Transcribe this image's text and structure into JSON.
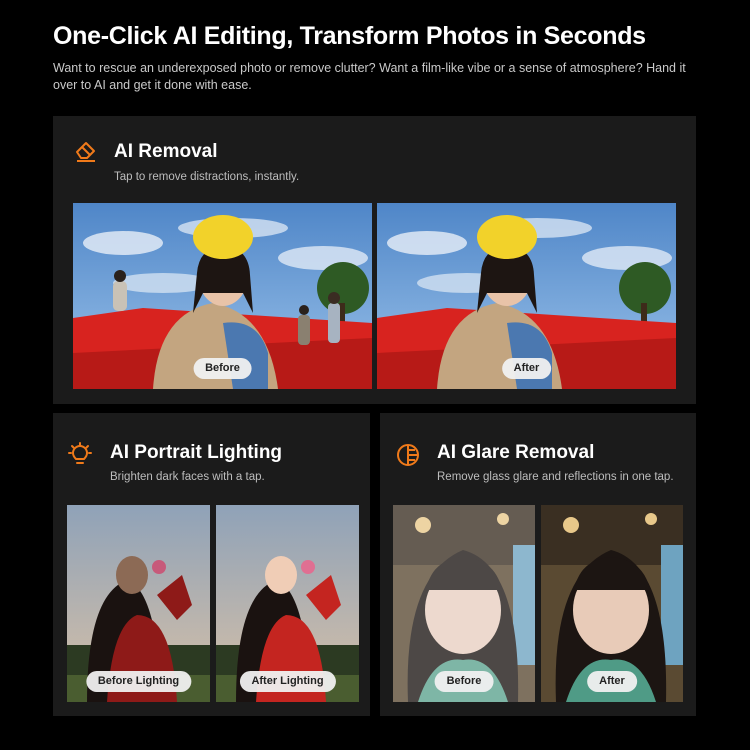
{
  "header": {
    "title": "One-Click AI Editing, Transform Photos in Seconds",
    "subtitle": "Want to rescue an underexposed photo or remove clutter? Want a film-like vibe or a sense of atmosphere? Hand it over to AI and get it done with ease."
  },
  "colors": {
    "background": "#000000",
    "card": "#1b1b1b",
    "accent": "#f07a1a",
    "pill": "#f0f0f0"
  },
  "features": {
    "removal": {
      "icon": "eraser-icon",
      "title": "AI Removal",
      "subtitle": "Tap to remove distractions, instantly.",
      "before_label": "Before",
      "after_label": "After"
    },
    "lighting": {
      "icon": "lightbulb-icon",
      "title": "AI Portrait Lighting",
      "subtitle": "Brighten dark faces with a tap.",
      "before_label": "Before Lighting",
      "after_label": "After Lighting"
    },
    "glare": {
      "icon": "glare-lens-icon",
      "title": "AI Glare Removal",
      "subtitle": "Remove glass glare and reflections in one tap.",
      "before_label": "Before",
      "after_label": "After"
    }
  }
}
